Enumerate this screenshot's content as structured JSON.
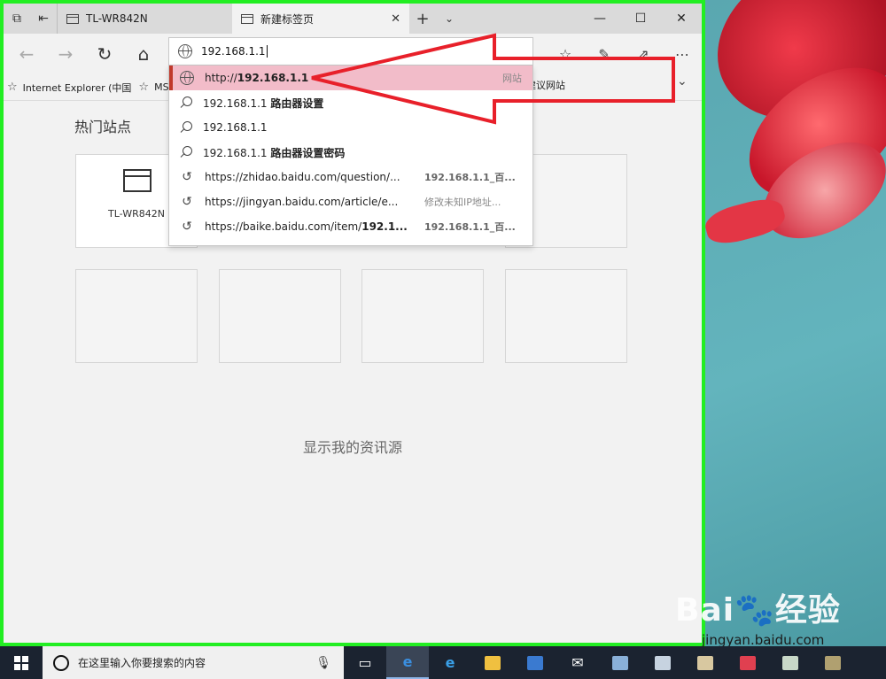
{
  "tabs": [
    {
      "label": "TL-WR842N",
      "active": false
    },
    {
      "label": "新建标签页",
      "active": true
    }
  ],
  "address_bar": {
    "value": "192.168.1.1"
  },
  "suggestions": [
    {
      "type": "site",
      "prefix": "http://",
      "bold": "192.168.1.1",
      "tag": "网站"
    },
    {
      "type": "search",
      "text": "192.168.1.1 ",
      "bold": "路由器设置"
    },
    {
      "type": "search",
      "text": "192.168.1.1",
      "bold": ""
    },
    {
      "type": "search",
      "text": "192.168.1.1 ",
      "bold": "路由器设置密码"
    },
    {
      "type": "history",
      "url": "https://zhidao.baidu.com/question/...",
      "title": "192.168.1.1_百..."
    },
    {
      "type": "history",
      "url": "https://jingyan.baidu.com/article/e...",
      "title": "修改未知IP地址..."
    },
    {
      "type": "history",
      "url": "https://baike.baidu.com/item/",
      "url_bold": "192.1...",
      "title": "192.168.1.1_百..."
    }
  ],
  "favorites": {
    "item1": "Internet Explorer (中国",
    "item2": "MS",
    "item3": "建议网站"
  },
  "content": {
    "section_title": "热门站点",
    "tile_label": "TL-WR842N",
    "news_link": "显示我的资讯源"
  },
  "taskbar": {
    "search_placeholder": "在这里输入你要搜索的内容"
  },
  "watermark": {
    "logo": "Bai",
    "logo2": "经验",
    "url": "jingyan.baidu.com"
  },
  "colors": {
    "window_border": "#22ee22",
    "highlight": "#f2bcc9",
    "annotation": "#e8202a"
  }
}
